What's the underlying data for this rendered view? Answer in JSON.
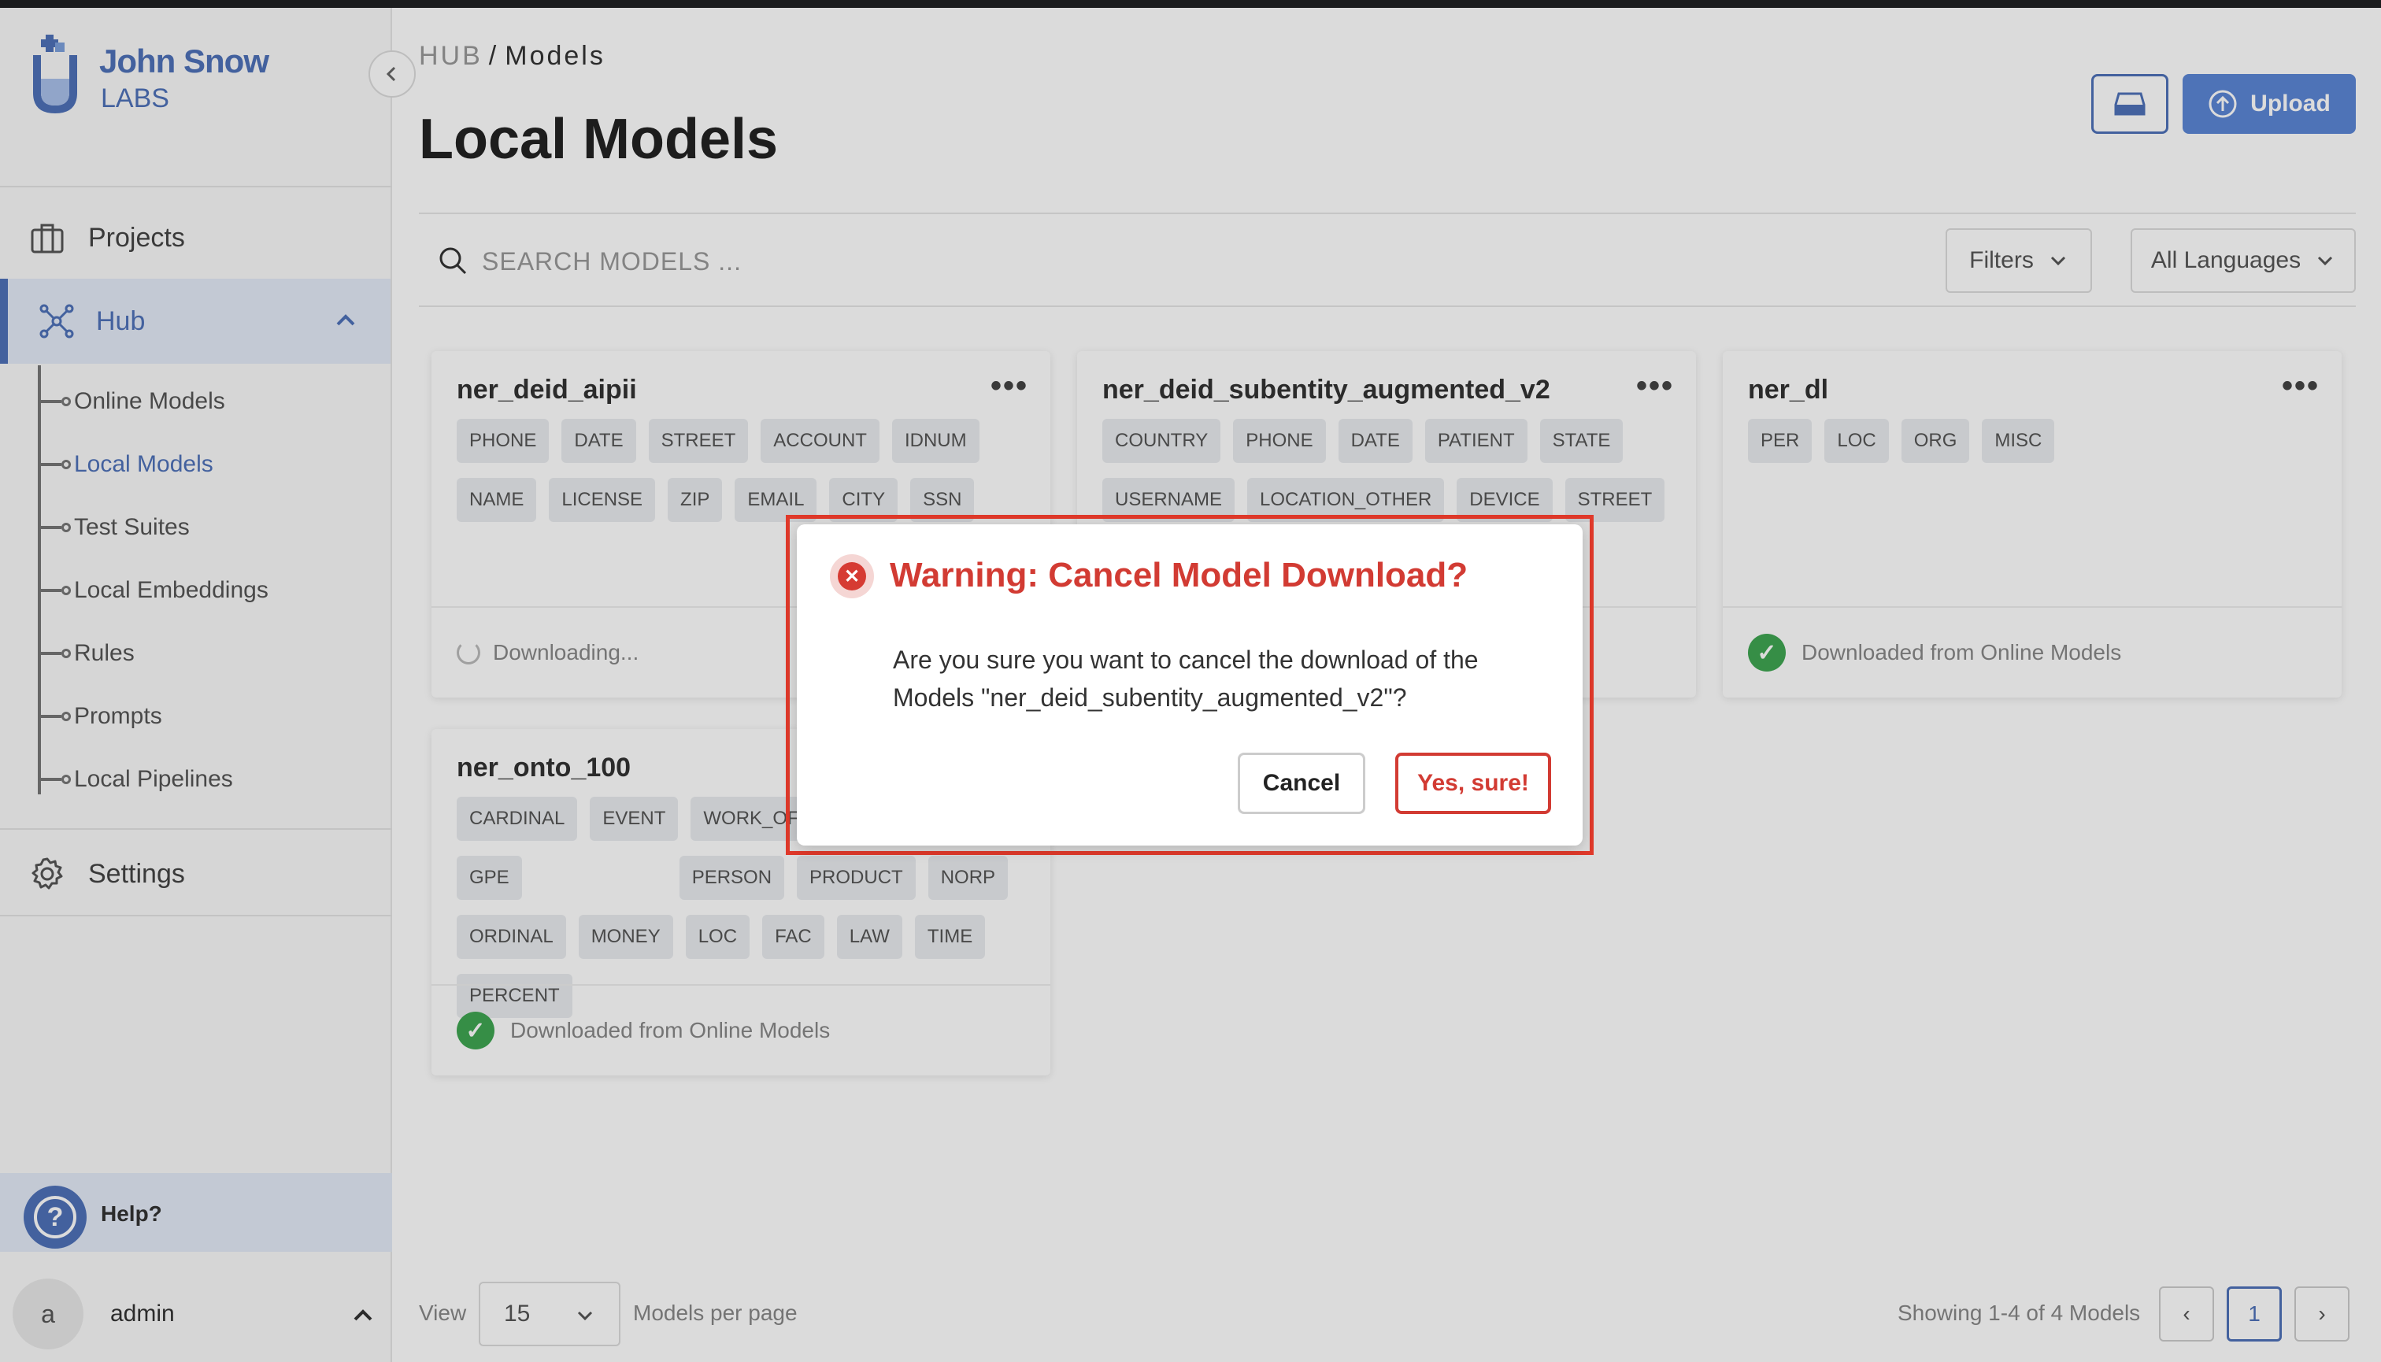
{
  "brand": {
    "line1": "John Snow",
    "line2": "LABS"
  },
  "sidebar": {
    "projects": "Projects",
    "hub": "Hub",
    "sub_items": [
      "Online Models",
      "Local Models",
      "Test Suites",
      "Local Embeddings",
      "Rules",
      "Prompts",
      "Local Pipelines"
    ],
    "active_sub": "Local Models",
    "settings": "Settings",
    "help": "Help?",
    "user_initial": "a",
    "user_name": "admin"
  },
  "breadcrumb": {
    "root": "HUB",
    "sep": "/",
    "current": "Models"
  },
  "page_title": "Local Models",
  "toolbar": {
    "upload_label": "Upload"
  },
  "search": {
    "placeholder": "SEARCH MODELS ...",
    "value": ""
  },
  "filters": {
    "filters_label": "Filters",
    "language_label": "All Languages"
  },
  "cards": [
    {
      "title": "ner_deid_aipii",
      "more": "•••",
      "tags": [
        "PHONE",
        "DATE",
        "STREET",
        "ACCOUNT",
        "IDNUM",
        "NAME",
        "LICENSE",
        "ZIP",
        "EMAIL",
        "CITY",
        "SSN"
      ],
      "status": "Downloading...",
      "status_kind": "downloading"
    },
    {
      "title": "ner_deid_subentity_augmented_v2",
      "more": "•••",
      "tags": [
        "COUNTRY",
        "PHONE",
        "DATE",
        "PATIENT",
        "STATE",
        "USERNAME",
        "LOCATION_OTHER",
        "DEVICE",
        "STREET"
      ],
      "status": "",
      "status_kind": "none"
    },
    {
      "title": "ner_dl",
      "more": "•••",
      "tags": [
        "PER",
        "LOC",
        "ORG",
        "MISC"
      ],
      "status": "Downloaded from Online Models",
      "status_kind": "downloaded"
    },
    {
      "title": "ner_onto_100",
      "more": "",
      "tags": [
        "CARDINAL",
        "EVENT",
        "WORK_OF_A",
        "GPE",
        "PERSON",
        "PRODUCT",
        "NORP",
        "ORDINAL",
        "MONEY",
        "LOC",
        "FAC",
        "LAW",
        "TIME",
        "PERCENT"
      ],
      "status": "Downloaded from Online Models",
      "status_kind": "downloaded"
    }
  ],
  "footer": {
    "view_label": "View",
    "per_page_value": "15",
    "per_page_label": "Models per page",
    "showing": "Showing 1-4 of 4 Models",
    "current_page": "1",
    "prev": "‹",
    "next": "›"
  },
  "modal": {
    "title": "Warning: Cancel Model Download?",
    "body": "Are you sure you want to cancel the download of the Models \"ner_deid_subentity_augmented_v2\"?",
    "cancel_label": "Cancel",
    "confirm_label": "Yes, sure!"
  },
  "colors": {
    "accent": "#4f72b9",
    "danger": "#d23b33",
    "success": "#3fa652"
  }
}
